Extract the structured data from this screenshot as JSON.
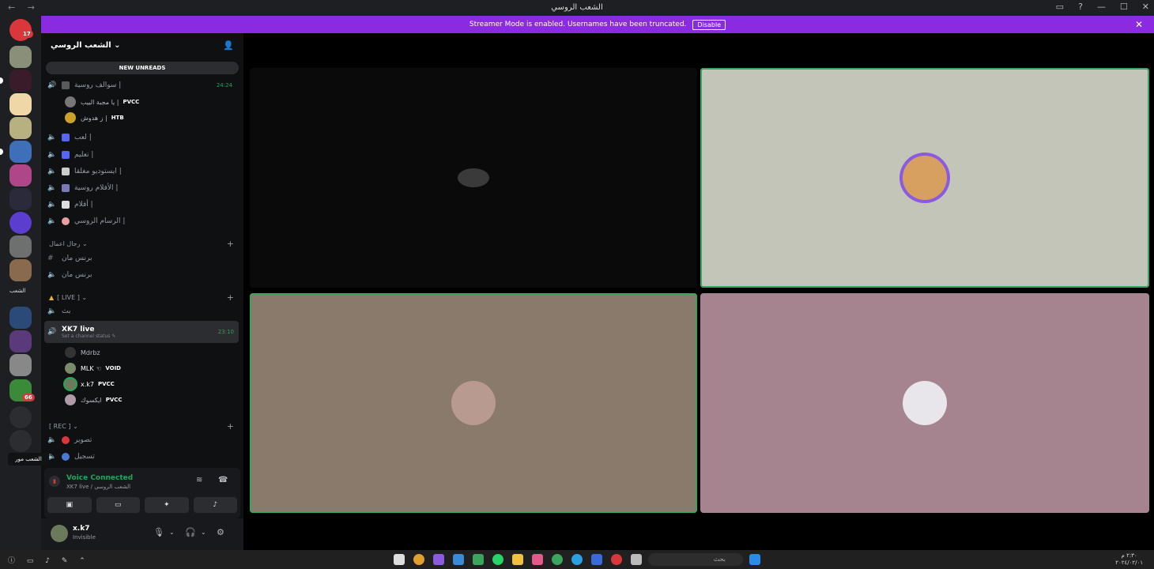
{
  "window": {
    "title": "الشعب الروسي",
    "nav": "← →",
    "controls": [
      "▭",
      "?",
      "—",
      "☐",
      "✕"
    ]
  },
  "banner": {
    "text": "Streamer Mode is enabled. Usernames have been truncated.",
    "disable_label": "Disable",
    "close": "✕",
    "color": "#8a2be2"
  },
  "rail": {
    "badges": [
      "17",
      "66"
    ],
    "label": "الشعب"
  },
  "server": {
    "name": "الشعب الروسي ⌄",
    "new_unreads": "NEW UNREADS"
  },
  "channels": {
    "voice1": {
      "name": "سوالف روسية |",
      "time": "24:24"
    },
    "voice1_users": [
      {
        "name": "يا مجبة الييب |",
        "tag": "PVCC"
      },
      {
        "name": "ز هدوش |",
        "tag": "HTB"
      }
    ],
    "list": [
      "لعب |",
      "تعليم |",
      "ايستوديو مغلقا |",
      "الأفلام روسية |",
      "أفلام |",
      "الرسام الروسي |"
    ],
    "cat_work": "رجال اعمال ⌄",
    "work_channels": [
      "برنس مان",
      "برنس مان"
    ],
    "cat_live": "[ LIVE ] ⌄",
    "live_first": "بث",
    "live_active": {
      "name": "XK7 live",
      "status": "Set a channel status ✎",
      "time": "23:10"
    },
    "live_users": [
      {
        "name": "Mdrbz",
        "tag": ""
      },
      {
        "name": "MLK ☜",
        "tag": "VOID"
      },
      {
        "name": "x.k7",
        "tag": "PVCC"
      },
      {
        "name": "ايكسوك",
        "tag": "PVCC"
      }
    ],
    "cat_rec": "[ REC ] ⌄",
    "rec_channels": [
      "تصوير",
      "تسجيل"
    ]
  },
  "tooltip": "الشعب مور",
  "voice_panel": {
    "title": "Voice Connected",
    "subtitle": "XK7 live / الشعب الروسي"
  },
  "user": {
    "name": "x.k7",
    "status": "Invisible"
  },
  "taskbar": {
    "search": "بحث",
    "clock_time": "٢:٣٠ م",
    "clock_date": "٢٠٢٤/٠٢/٠١"
  }
}
